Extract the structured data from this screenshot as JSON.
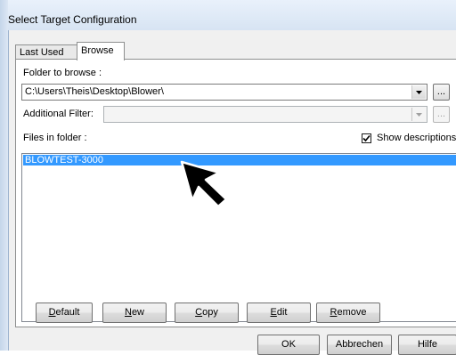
{
  "window": {
    "title": "Select Target Configuration"
  },
  "tabs": [
    {
      "label": "Last Used",
      "active": false
    },
    {
      "label": "Browse",
      "active": true
    }
  ],
  "folder": {
    "label": "Folder to browse :",
    "value": "C:\\Users\\Theis\\Desktop\\Blower\\",
    "browse_label": "..."
  },
  "filter": {
    "label": "Additional Filter:",
    "value": "",
    "browse_label": "..."
  },
  "files": {
    "label": "Files in folder :",
    "show_descriptions_label": "Show descriptions",
    "show_descriptions_checked": true,
    "items": [
      {
        "name": "BLOWTEST-3000",
        "selected": true
      }
    ]
  },
  "actions": {
    "default": {
      "mnemonic": "D",
      "rest": "efault"
    },
    "new": {
      "mnemonic": "N",
      "rest": "ew"
    },
    "copy": {
      "mnemonic": "C",
      "rest": "opy"
    },
    "edit": {
      "mnemonic": "E",
      "rest": "dit"
    },
    "remove": {
      "mnemonic": "R",
      "rest": "emove"
    }
  },
  "dialog_buttons": {
    "ok": "OK",
    "cancel": "Abbrechen",
    "help": "Hilfe"
  },
  "colors": {
    "selection": "#3399ff",
    "titlebar": "#dfe9f5"
  },
  "icons": [
    "combo-arrow-icon",
    "checkmark-icon",
    "mouse-cursor-icon"
  ]
}
